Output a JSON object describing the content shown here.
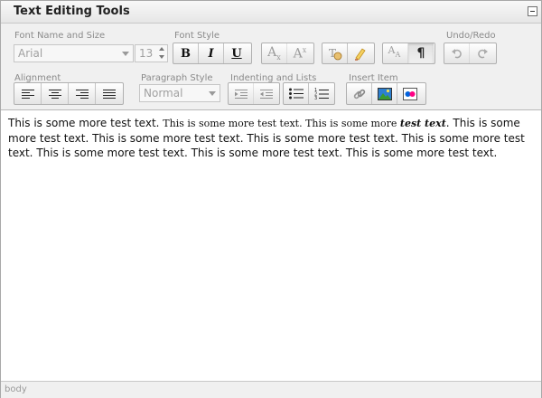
{
  "header": {
    "title": "Text Editing Tools"
  },
  "toolbar": {
    "font_name_size_label": "Font Name and Size",
    "font_style_label": "Font Style",
    "undo_redo_label": "Undo/Redo",
    "alignment_label": "Alignment",
    "paragraph_style_label": "Paragraph Style",
    "indenting_lists_label": "Indenting and Lists",
    "insert_item_label": "Insert Item",
    "font_name_value": "Arial",
    "font_size_value": "13",
    "paragraph_style_value": "Normal",
    "bold_label": "B",
    "italic_label": "I",
    "underline_label": "U",
    "subscript_base": "A",
    "subscript_mark": "x",
    "superscript_base": "A",
    "superscript_mark": "x",
    "font_size_big": "A",
    "font_size_small": "A"
  },
  "editor": {
    "seg1": "This is some more test text. ",
    "seg2": "This is some more test text. This is some more ",
    "seg3": "test text",
    "seg4": ". This is some more test text. This is some more test text. This is some more test text. This is some more test text. This is some more test text. This is some more test text. This is some more test text."
  },
  "status": {
    "path": "body"
  },
  "colors": {
    "toolbar_bg": "#f0f0f0",
    "border": "#a8a8a8",
    "label_gray": "#8a8a8a",
    "disabled_gray": "#a0a0a0"
  }
}
